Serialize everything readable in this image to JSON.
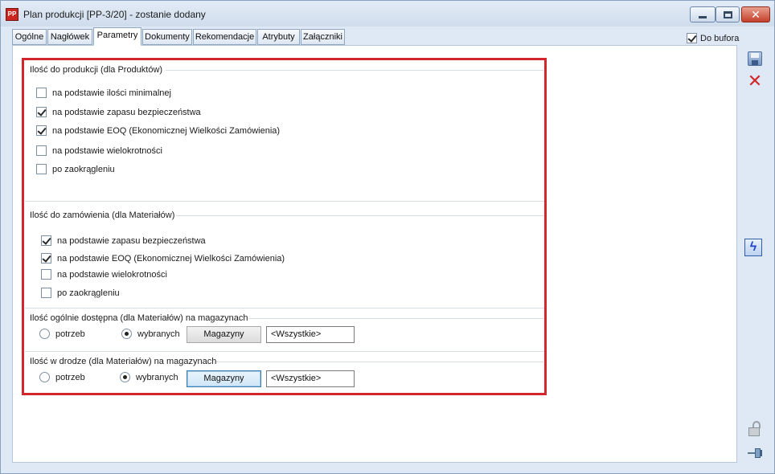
{
  "window": {
    "title": "Plan produkcji [PP-3/20] - zostanie dodany",
    "app_icon": "PP"
  },
  "tabs": [
    {
      "label": "Ogólne",
      "active": false
    },
    {
      "label": "Nagłówek",
      "active": false
    },
    {
      "label": "Parametry",
      "active": true
    },
    {
      "label": "Dokumenty",
      "active": false
    },
    {
      "label": "Rekomendacje",
      "active": false
    },
    {
      "label": "Atrybuty",
      "active": false
    },
    {
      "label": "Załączniki",
      "active": false
    }
  ],
  "do_bufora": {
    "label": "Do bufora",
    "checked": true
  },
  "production_group": {
    "title": "Ilość do produkcji (dla Produktów)",
    "options": [
      {
        "label": "na podstawie ilości minimalnej",
        "checked": false
      },
      {
        "label": "na podstawie zapasu bezpieczeństwa",
        "checked": true
      },
      {
        "label": "na podstawie EOQ (Ekonomicznej Wielkości Zamówienia)",
        "checked": true
      },
      {
        "label": "na podstawie wielokrotności",
        "checked": false
      },
      {
        "label": "po zaokrągleniu",
        "checked": false
      }
    ]
  },
  "order_group": {
    "title": "Ilość do zamówienia (dla Materiałów)",
    "options": [
      {
        "label": "na podstawie zapasu bezpieczeństwa",
        "checked": true
      },
      {
        "label": "na podstawie EOQ (Ekonomicznej Wielkości Zamówienia)",
        "checked": true
      },
      {
        "label": "na podstawie wielokrotności",
        "checked": false
      },
      {
        "label": "po zaokrągleniu",
        "checked": false
      }
    ]
  },
  "available_group": {
    "title": "Ilość ogólnie dostępna (dla Materiałów) na magazynach",
    "radio_need": "potrzeb",
    "radio_selected": "wybranych",
    "selected": "wybranych",
    "button": "Magazyny",
    "value": "<Wszystkie>"
  },
  "transit_group": {
    "title": "Ilość w drodze (dla Materiałów) na magazynach",
    "radio_need": "potrzeb",
    "radio_selected": "wybranych",
    "selected": "wybranych",
    "button": "Magazyny",
    "value": "<Wszystkie>"
  },
  "icons": {
    "save": "save-icon",
    "cancel": "close-x-icon",
    "action": "lightning-icon",
    "lock": "unlock-icon",
    "pin": "pin-icon"
  }
}
